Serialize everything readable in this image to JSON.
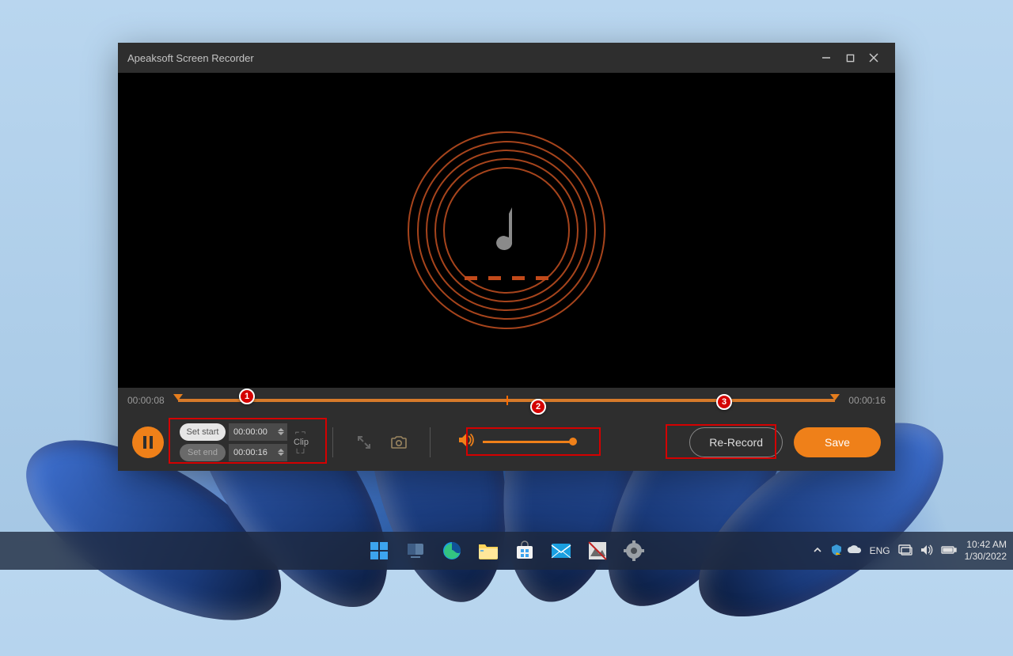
{
  "app": {
    "title": "Apeaksoft Screen Recorder"
  },
  "timeline": {
    "current": "00:00:08",
    "total": "00:00:16"
  },
  "clip": {
    "set_start_label": "Set start",
    "set_end_label": "Set end",
    "start_time": "00:00:00",
    "end_time": "00:00:16",
    "clip_label": "Clip"
  },
  "buttons": {
    "re_record": "Re-Record",
    "save": "Save"
  },
  "callouts": {
    "c1": "1",
    "c2": "2",
    "c3": "3"
  },
  "taskbar": {
    "lang": "ENG",
    "time": "10:42 AM",
    "date": "1/30/2022"
  }
}
